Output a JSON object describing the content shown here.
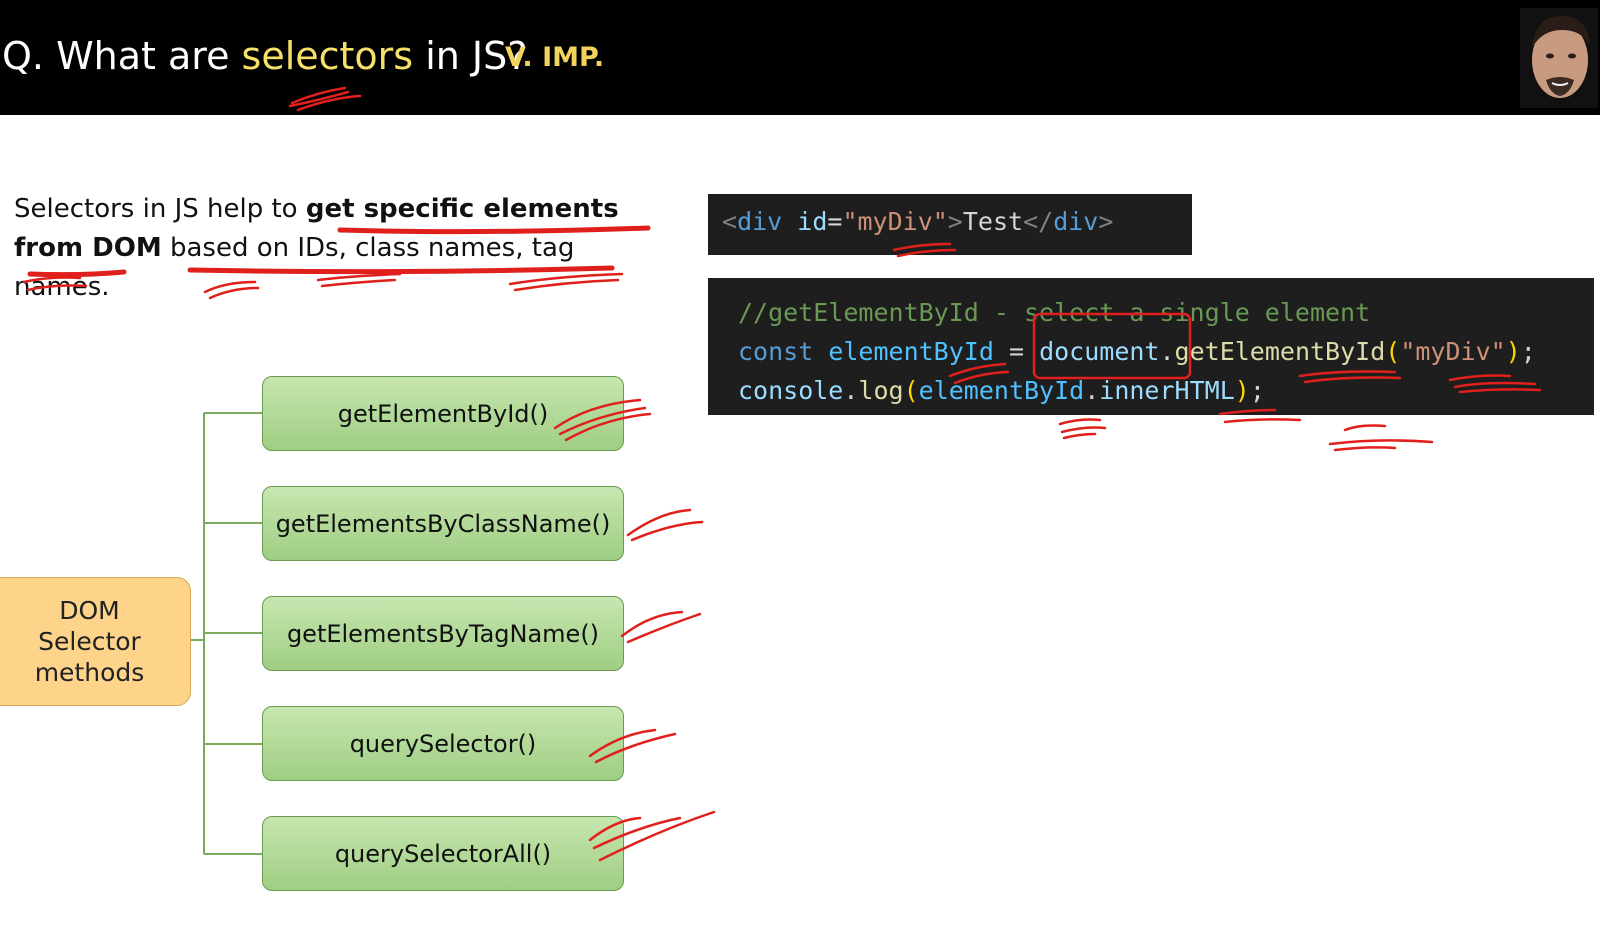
{
  "header": {
    "title_prefix": "Q. What are ",
    "title_highlight": "selectors",
    "title_suffix": " in JS?",
    "badge": "V. IMP."
  },
  "intro": {
    "part1": "Selectors in JS help to ",
    "bold": "get specific elements from DOM",
    "part2": " based on IDs, class names, tag names."
  },
  "code_html": {
    "lt": "<",
    "tag": "div",
    "attr": " id",
    "eq": "=",
    "val": "\"myDiv\"",
    "gt": ">",
    "text": "Test",
    "close_open": "</",
    "close_tag": "div",
    "close_gt": ">"
  },
  "code_js": {
    "comment": "//getElementById - select a single element",
    "kw": "const",
    "var": "elementById",
    "eq": " = ",
    "obj": "document",
    "dot": ".",
    "fn": "getElementById",
    "open": "(",
    "arg": "\"myDiv\"",
    "close": ")",
    "semi": ";",
    "console": "console",
    "log": "log",
    "var2": "elementById",
    "prop": "innerHTML"
  },
  "diagram": {
    "root": "DOM Selector methods",
    "methods": [
      "getElementById()",
      "getElementsByClassName()",
      "getElementsByTagName()",
      "querySelector()",
      "querySelectorAll()"
    ]
  },
  "colors": {
    "header_bg": "#000000",
    "highlight": "#f7e06a",
    "badge": "#f2d35c",
    "annotation": "#e0201c",
    "node_green": "#a9d48e",
    "root_orange": "#fdd48a",
    "code_bg": "#1e1e1e"
  }
}
